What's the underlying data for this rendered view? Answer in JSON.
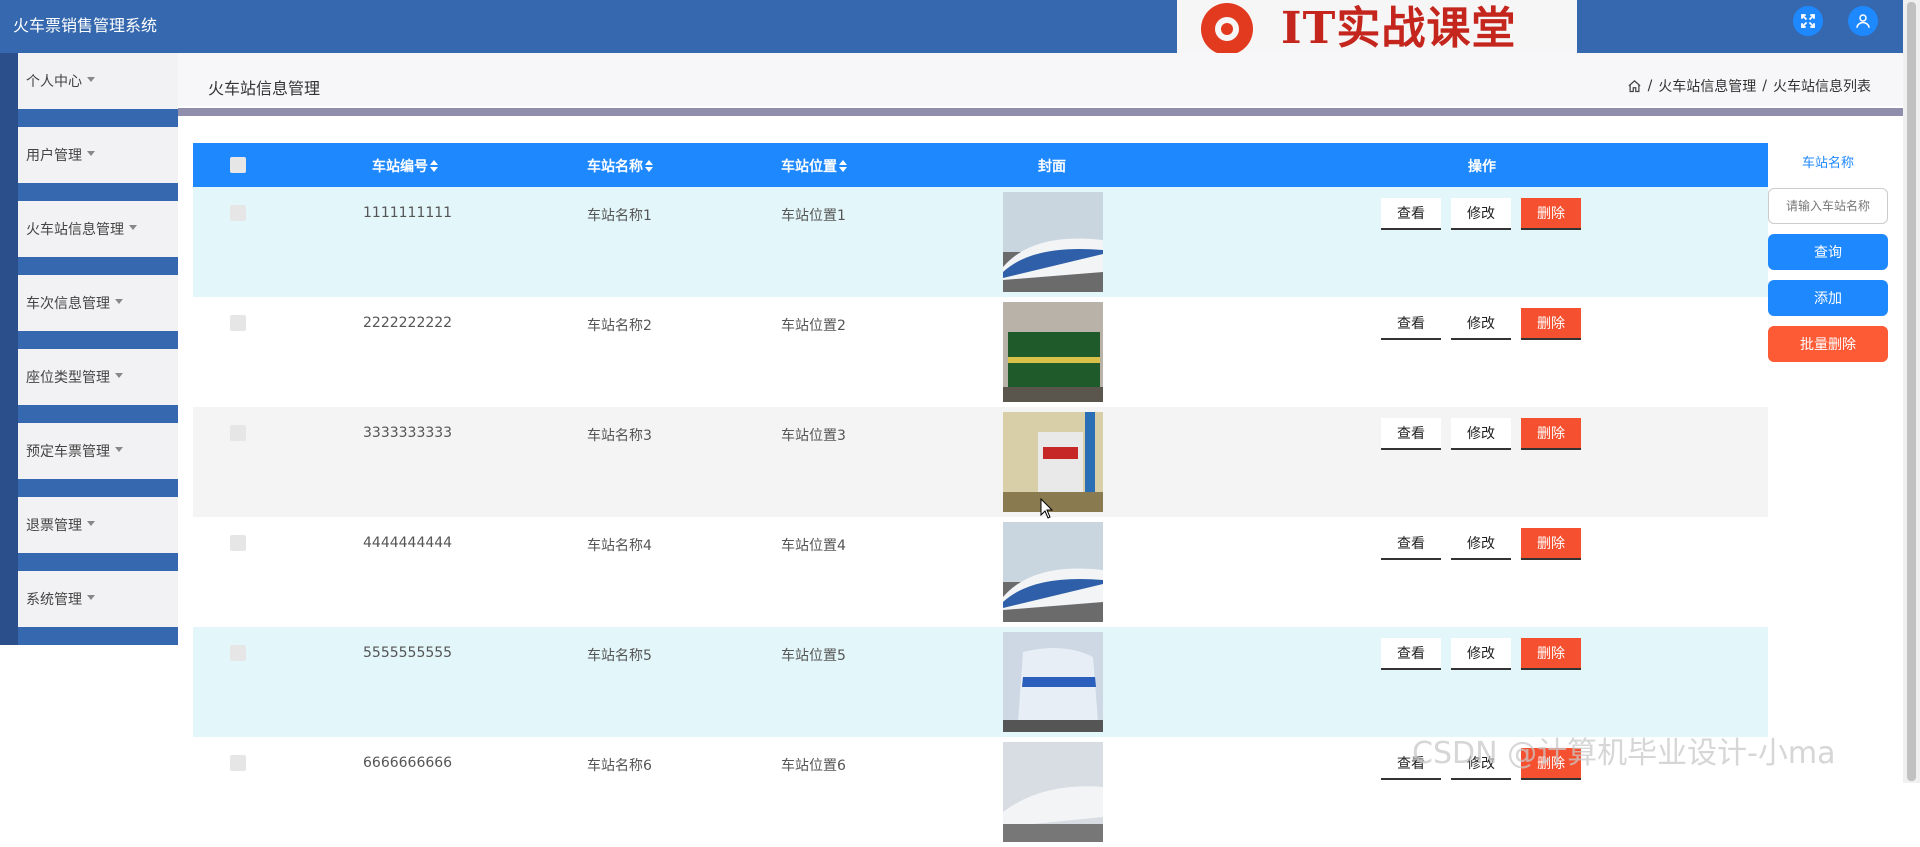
{
  "app": {
    "title": "火车票销售管理系统"
  },
  "logo": {
    "text": "IT实战课堂"
  },
  "topbar": {
    "icons": [
      "fullscreen-icon",
      "user-icon"
    ]
  },
  "sidebar": {
    "items": [
      {
        "label": "个人中心"
      },
      {
        "label": "用户管理"
      },
      {
        "label": "火车站信息管理"
      },
      {
        "label": "车次信息管理"
      },
      {
        "label": "座位类型管理"
      },
      {
        "label": "预定车票管理"
      },
      {
        "label": "退票管理"
      },
      {
        "label": "系统管理"
      }
    ]
  },
  "page": {
    "title": "火车站信息管理",
    "breadcrumb": [
      "火车站信息管理",
      "火车站信息列表"
    ],
    "breadcrumb_sep": "/"
  },
  "table": {
    "headers": {
      "code": "车站编号",
      "name": "车站名称",
      "location": "车站位置",
      "cover": "封面",
      "actions": "操作"
    },
    "actions": {
      "view": "查看",
      "edit": "修改",
      "delete": "删除"
    },
    "rows": [
      {
        "code": "1111111111",
        "name": "车站名称1",
        "location": "车站位置1"
      },
      {
        "code": "2222222222",
        "name": "车站名称2",
        "location": "车站位置2"
      },
      {
        "code": "3333333333",
        "name": "车站名称3",
        "location": "车站位置3"
      },
      {
        "code": "4444444444",
        "name": "车站名称4",
        "location": "车站位置4"
      },
      {
        "code": "5555555555",
        "name": "车站名称5",
        "location": "车站位置5"
      },
      {
        "code": "6666666666",
        "name": "车站名称6",
        "location": "车站位置6"
      }
    ]
  },
  "search": {
    "label": "车站名称",
    "placeholder": "请输入车站名称",
    "query_label": "查询",
    "add_label": "添加",
    "batch_delete_label": "批量删除"
  },
  "watermark": {
    "text": "CSDN @计算机毕业设计-小ma"
  },
  "colors": {
    "topbar": "#3568ae",
    "accent": "#1e88ff",
    "danger": "#f5502f",
    "row_alt": "#e3f6fa"
  }
}
